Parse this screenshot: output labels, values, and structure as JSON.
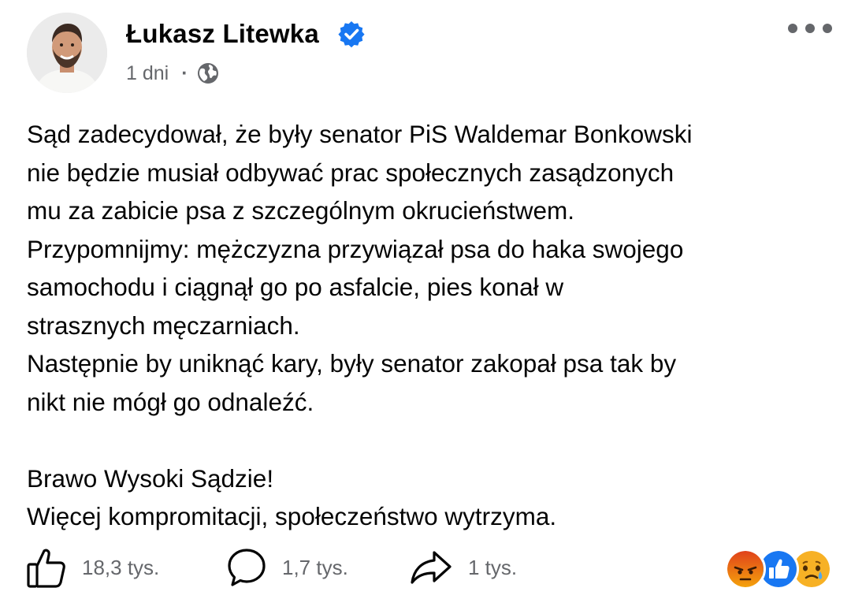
{
  "post": {
    "author_name": "Łukasz Litewka",
    "verified_icon": "verified-badge-icon",
    "timestamp": "1 dni",
    "separator": "·",
    "audience_icon": "globe-icon",
    "body_lines": [
      "Sąd zadecydował, że były senator PiS Waldemar Bonkowski",
      "nie będzie musiał odbywać prac społecznych zasądzonych",
      "mu za zabicie psa z szczególnym okrucieństwem.",
      "Przypomnijmy: mężczyzna przywiązał psa do haka swojego",
      "samochodu i ciągnął go po asfalcie, pies konał w",
      "strasznych męczarniach.",
      "Następnie by uniknąć kary, były senator zakopał psa tak by",
      "nikt nie mógł go odnaleźć.",
      "",
      "Brawo Wysoki Sądzie!",
      "Więcej kompromitacji, społeczeństwo wytrzyma."
    ]
  },
  "actions": {
    "like_icon": "thumbs-up-icon",
    "like_count": "18,3 tys.",
    "comment_icon": "comment-bubble-icon",
    "comment_count": "1,7 tys.",
    "share_icon": "share-arrow-icon",
    "share_count": "1 tys."
  },
  "reactions": [
    "angry-reaction-icon",
    "like-reaction-icon",
    "sad-reaction-icon"
  ],
  "colors": {
    "text": "#050505",
    "secondary_text": "#65676b",
    "verified_blue": "#1877f2",
    "like_blue": "#1877f2",
    "angry_orange": "#e9710f",
    "sad_yellow": "#f7b125"
  }
}
